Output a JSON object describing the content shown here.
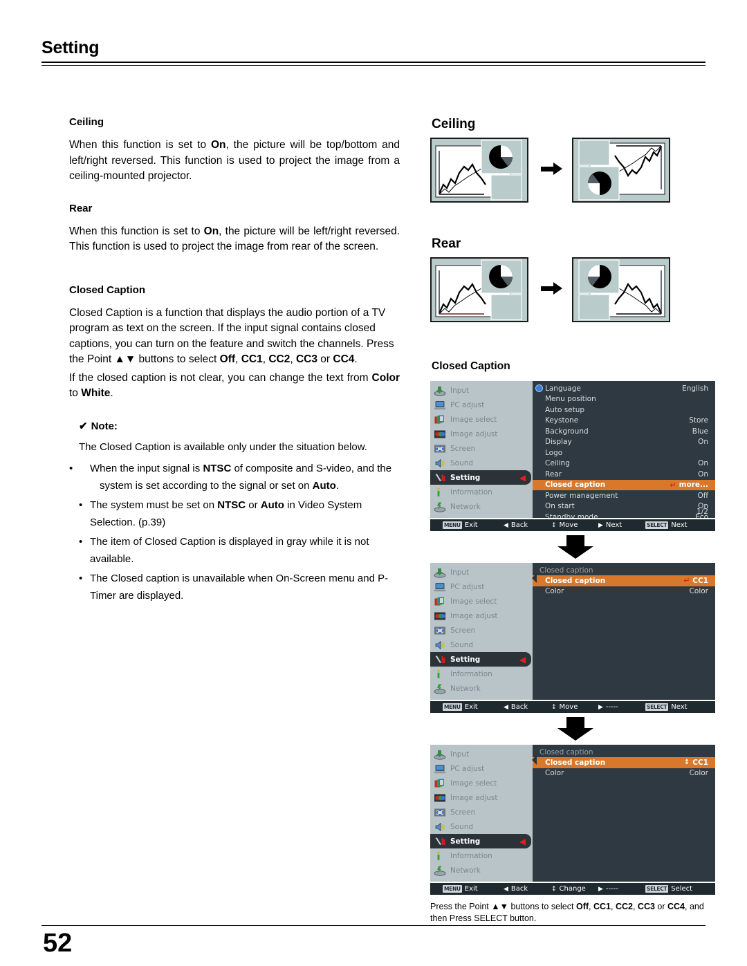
{
  "header": {
    "title": "Setting"
  },
  "footer": {
    "page_number": "52"
  },
  "left": {
    "ceiling_heading": "Ceiling",
    "ceiling_body_pre": "When this function is set to ",
    "ceiling_body_on": "On",
    "ceiling_body_post": ", the picture will be top/bottom and left/right reversed. This function is used to project the image from a ceiling-mounted projector.",
    "rear_heading": "Rear",
    "rear_body_pre": "When this function is set to ",
    "rear_body_on": "On",
    "rear_body_post": ", the picture will be left/right reversed. This function is used to project the image from rear of the screen.",
    "cc_heading": "Closed Caption",
    "cc_body_1": "Closed Caption is a function that displays the audio portion of a TV program as text on the screen. If the input signal contains closed captions, you can turn on the feature and switch the channels. Press the Point ▲▼ buttons to select ",
    "cc_opt_off": "Off",
    "cc_opt_cc1": "CC1",
    "cc_opt_cc2": "CC2",
    "cc_opt_cc3": "CC3",
    "cc_opt_or": " or ",
    "cc_opt_cc4": "CC4",
    "cc_body_2_pre": "If the closed caption is not clear, you can change the text from ",
    "cc_color": "Color",
    "cc_to": " to ",
    "cc_white": "White",
    "note_check": "✔",
    "note_label": "Note:",
    "note_body": "The Closed Caption is available only under the situation below.",
    "note_items": [
      {
        "bullet": "•",
        "parts": [
          "When the input signal is ",
          "NTSC",
          " of composite and S-video, and the system is set according to the signal or set on ",
          "Auto",
          "."
        ],
        "bold_flags": [
          false,
          true,
          false,
          true,
          false
        ]
      },
      {
        "bullet": "•",
        "parts": [
          "The system must be set on ",
          "NTSC",
          " or ",
          "Auto",
          " in Video System Selection. (p.39)"
        ],
        "bold_flags": [
          false,
          true,
          false,
          true,
          false
        ]
      },
      {
        "bullet": "•",
        "parts": [
          "The item of Closed Caption is displayed in gray while it is not available."
        ],
        "bold_flags": [
          false
        ]
      },
      {
        "bullet": "•",
        "parts": [
          "The Closed caption is unavailable when On-Screen menu and P-Timer are displayed."
        ],
        "bold_flags": [
          false
        ]
      }
    ]
  },
  "right": {
    "ceiling_heading": "Ceiling",
    "rear_heading": "Rear",
    "cc_heading": "Closed Caption"
  },
  "colors": {
    "highlight": "#d9782b",
    "osd_bg": "#2f3942",
    "osd_sidebar": "#b9c4c9",
    "osd_active": "#2b3339",
    "caret_red": "#e02020",
    "diagram_fill": "#b9cbcb"
  },
  "osd": {
    "sidebar_items": [
      {
        "label": "Input",
        "icon": "input-icon",
        "active": false
      },
      {
        "label": "PC adjust",
        "icon": "pc-adjust-icon",
        "active": false
      },
      {
        "label": "Image select",
        "icon": "image-select-icon",
        "active": false
      },
      {
        "label": "Image adjust",
        "icon": "image-adjust-icon",
        "active": false
      },
      {
        "label": "Screen",
        "icon": "screen-icon",
        "active": false
      },
      {
        "label": "Sound",
        "icon": "sound-icon",
        "active": false
      },
      {
        "label": "Setting",
        "icon": "setting-icon",
        "active": true
      },
      {
        "label": "Information",
        "icon": "information-icon",
        "active": false
      },
      {
        "label": "Network",
        "icon": "network-icon",
        "active": false
      }
    ],
    "menu1": {
      "rows": [
        {
          "label": "Language",
          "value": "English",
          "highlight": false,
          "globe": true
        },
        {
          "label": "Menu position",
          "value": "",
          "highlight": false
        },
        {
          "label": "Auto setup",
          "value": "",
          "highlight": false
        },
        {
          "label": "Keystone",
          "value": "Store",
          "highlight": false
        },
        {
          "label": "Background",
          "value": "Blue",
          "highlight": false
        },
        {
          "label": "Display",
          "value": "On",
          "highlight": false
        },
        {
          "label": "Logo",
          "value": "",
          "highlight": false
        },
        {
          "label": "Ceiling",
          "value": "On",
          "highlight": false
        },
        {
          "label": "Rear",
          "value": "On",
          "highlight": false
        },
        {
          "label": "Closed caption",
          "value": "more...",
          "highlight": true,
          "enter_mark": true
        },
        {
          "label": "Power management",
          "value": "Off",
          "highlight": false
        },
        {
          "label": "On start",
          "value": "On",
          "highlight": false
        },
        {
          "label": "Standby mode",
          "value": "Eco",
          "highlight": false
        }
      ],
      "page_indicator": "1/2",
      "bar": [
        {
          "key": "MENU",
          "label": "Exit",
          "glyph": ""
        },
        {
          "key": "",
          "label": "Back",
          "glyph": "◀"
        },
        {
          "key": "",
          "label": "Move",
          "glyph": "↕"
        },
        {
          "key": "",
          "label": "Next",
          "glyph": "▶"
        },
        {
          "key": "SELECT",
          "label": "Next",
          "glyph": ""
        }
      ]
    },
    "menu2": {
      "title": "Closed caption",
      "rows": [
        {
          "label": "Closed caption",
          "value": "CC1",
          "highlight": true,
          "enter_mark": true
        },
        {
          "label": "Color",
          "value": "Color",
          "highlight": false
        }
      ],
      "bar": [
        {
          "key": "MENU",
          "label": "Exit",
          "glyph": ""
        },
        {
          "key": "",
          "label": "Back",
          "glyph": "◀"
        },
        {
          "key": "",
          "label": "Move",
          "glyph": "↕"
        },
        {
          "key": "",
          "label": "-----",
          "glyph": "▶"
        },
        {
          "key": "SELECT",
          "label": "Next",
          "glyph": ""
        }
      ]
    },
    "menu3": {
      "title": "Closed caption",
      "rows": [
        {
          "label": "Closed caption",
          "value": "CC1",
          "highlight": true,
          "ud_mark": true
        },
        {
          "label": "Color",
          "value": "Color",
          "highlight": false
        }
      ],
      "bar": [
        {
          "key": "MENU",
          "label": "Exit",
          "glyph": ""
        },
        {
          "key": "",
          "label": "Back",
          "glyph": "◀"
        },
        {
          "key": "",
          "label": "Change",
          "glyph": "↕"
        },
        {
          "key": "",
          "label": "-----",
          "glyph": "▶"
        },
        {
          "key": "SELECT",
          "label": "Select",
          "glyph": ""
        }
      ]
    },
    "caption": {
      "pre": "Press the Point ▲▼ buttons to select ",
      "off": "Off",
      "cc1": "CC1",
      "cc2": "CC2",
      "cc3": "CC3",
      "or": " or ",
      "cc4": "CC4",
      "post": ", and then Press SELECT button."
    }
  }
}
